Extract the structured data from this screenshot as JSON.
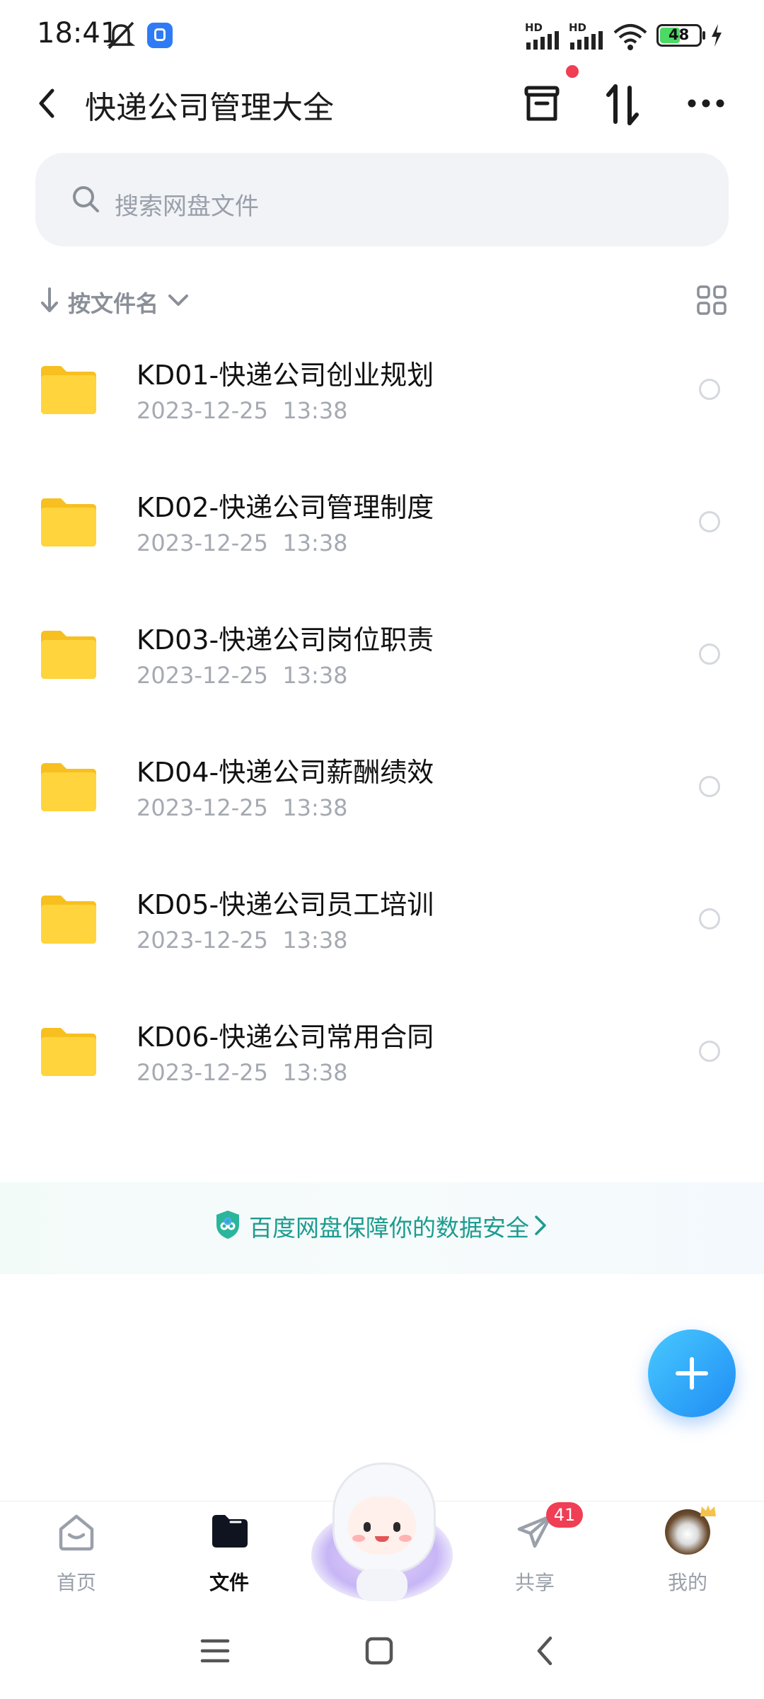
{
  "status_bar": {
    "time": "18:41",
    "battery": "48",
    "signal_1_label": "HD",
    "signal_2_label": "HD"
  },
  "header": {
    "title": "快递公司管理大全"
  },
  "search": {
    "placeholder": "搜索网盘文件"
  },
  "sort": {
    "label": "按文件名"
  },
  "files": [
    {
      "name": "KD01-快递公司创业规划",
      "date": "2023-12-25  13:38"
    },
    {
      "name": "KD02-快递公司管理制度",
      "date": "2023-12-25  13:38"
    },
    {
      "name": "KD03-快递公司岗位职责",
      "date": "2023-12-25  13:38"
    },
    {
      "name": "KD04-快递公司薪酬绩效",
      "date": "2023-12-25  13:38"
    },
    {
      "name": "KD05-快递公司员工培训",
      "date": "2023-12-25  13:38"
    },
    {
      "name": "KD06-快递公司常用合同",
      "date": "2023-12-25  13:38"
    }
  ],
  "banner": {
    "text": "百度网盘保障你的数据安全"
  },
  "bottom_nav": {
    "home": "首页",
    "files": "文件",
    "share": "共享",
    "share_badge": "41",
    "mine": "我的"
  },
  "colors": {
    "accent": "#1f8cf4",
    "badge": "#f03e55",
    "folder": "#ffd23a",
    "banner_text": "#1c9c8f"
  }
}
